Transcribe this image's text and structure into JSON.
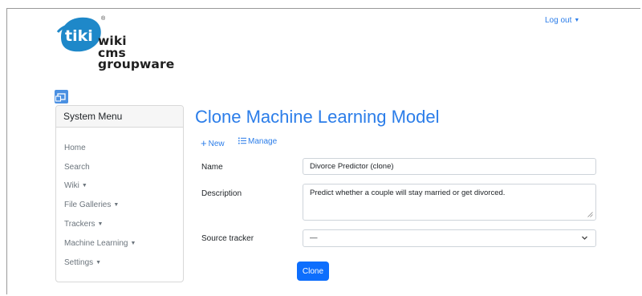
{
  "header": {
    "logo": {
      "badge": "tiki",
      "registered": "®",
      "line1": "wiki",
      "line2": "cms",
      "line3": "groupware"
    },
    "logout": {
      "label": "Log out",
      "caret": "▼"
    }
  },
  "sidebar": {
    "title": "System Menu",
    "items": [
      {
        "label": "Home",
        "caret": ""
      },
      {
        "label": "Search",
        "caret": ""
      },
      {
        "label": "Wiki",
        "caret": "▼"
      },
      {
        "label": "File Galleries",
        "caret": "▼"
      },
      {
        "label": "Trackers",
        "caret": "▼"
      },
      {
        "label": "Machine Learning",
        "caret": "▼"
      },
      {
        "label": "Settings",
        "caret": "▼"
      }
    ]
  },
  "main": {
    "title": "Clone Machine Learning Model",
    "toolbar": {
      "new_label": "New",
      "manage_label": "Manage"
    },
    "form": {
      "name_label": "Name",
      "name_value": "Divorce Predictor (clone)",
      "description_label": "Description",
      "description_value": "Predict whether a couple will stay married or get divorced.",
      "source_label": "Source tracker",
      "source_value": "—",
      "submit_label": "Clone"
    }
  },
  "colors": {
    "accent": "#2b7de9",
    "primary_button": "#0d6efd",
    "logo_blue": "#1e88c9"
  },
  "icons": {
    "new": "plus-icon",
    "manage": "list-icon",
    "toggle": "menu-toggle-icon",
    "select": "chevron-down-icon"
  }
}
